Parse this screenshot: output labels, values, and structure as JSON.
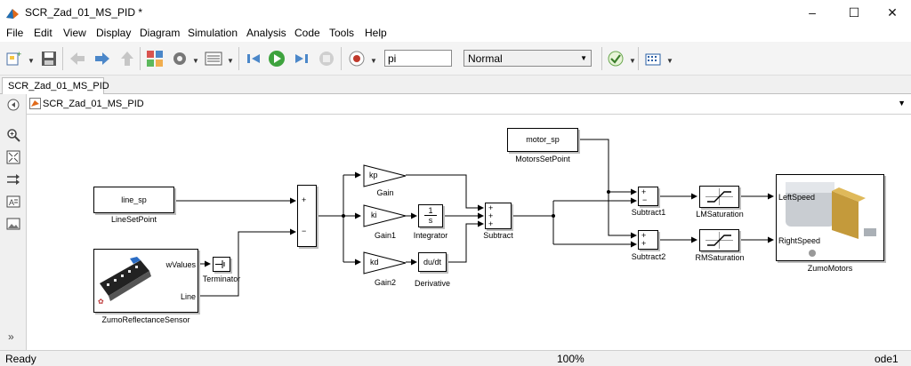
{
  "window": {
    "title": "SCR_Zad_01_MS_PID *",
    "minimize_icon": "minimize-icon",
    "maximize_icon": "maximize-icon",
    "close_icon": "close-icon"
  },
  "menu": [
    "File",
    "Edit",
    "View",
    "Display",
    "Diagram",
    "Simulation",
    "Analysis",
    "Code",
    "Tools",
    "Help"
  ],
  "toolbar": {
    "stop_time": "pi",
    "sim_mode": "Normal",
    "icons": [
      "new-model-icon",
      "save-icon",
      "back-icon",
      "forward-icon",
      "up-icon",
      "library-browser-icon",
      "model-config-icon",
      "model-explorer-icon",
      "step-back-icon",
      "run-icon",
      "step-forward-icon",
      "stop-icon",
      "record-icon",
      "model-advisor-icon",
      "build-icon"
    ]
  },
  "tab": {
    "label": "SCR_Zad_01_MS_PID"
  },
  "address": {
    "crumb": "SCR_Zad_01_MS_PID"
  },
  "sidebar_icons": [
    "hide-browser-icon",
    "zoom-icon",
    "fit-view-icon",
    "route-icon",
    "annotation-icon",
    "image-icon",
    "expand-icon"
  ],
  "diagram": {
    "blocks": {
      "line_sp": {
        "text": "line_sp",
        "label": "LineSetPoint"
      },
      "motor_sp": {
        "text": "motor_sp",
        "label": "MotorsSetPoint"
      },
      "sensor": {
        "label": "ZumoReflectanceSensor",
        "port1": "wValues",
        "port2": "Line"
      },
      "terminator": {
        "label": "Terminator"
      },
      "sum1": {
        "plus": "+",
        "minus": "−"
      },
      "gain": {
        "text": "kp",
        "label": "Gain"
      },
      "gain1": {
        "text": "ki",
        "label": "Gain1"
      },
      "gain2": {
        "text": "kd",
        "label": "Gain2"
      },
      "integrator": {
        "num": "1",
        "den": "s",
        "label": "Integrator"
      },
      "derivative": {
        "text": "du/dt",
        "label": "Derivative"
      },
      "subtract": {
        "signs": [
          "+",
          "+",
          "+"
        ],
        "label": "Subtract"
      },
      "subtract1": {
        "signs": [
          "+",
          "−"
        ],
        "label": "Subtract1"
      },
      "subtract2": {
        "signs": [
          "+",
          "+"
        ],
        "label": "Subtract2"
      },
      "lmsat": {
        "label": "LMSaturation"
      },
      "rmsat": {
        "label": "RMSaturation"
      },
      "motors": {
        "label": "ZumoMotors",
        "port1": "LeftSpeed",
        "port2": "RightSpeed"
      }
    }
  },
  "status": {
    "left": "Ready",
    "zoom": "100%",
    "solver": "ode1"
  }
}
